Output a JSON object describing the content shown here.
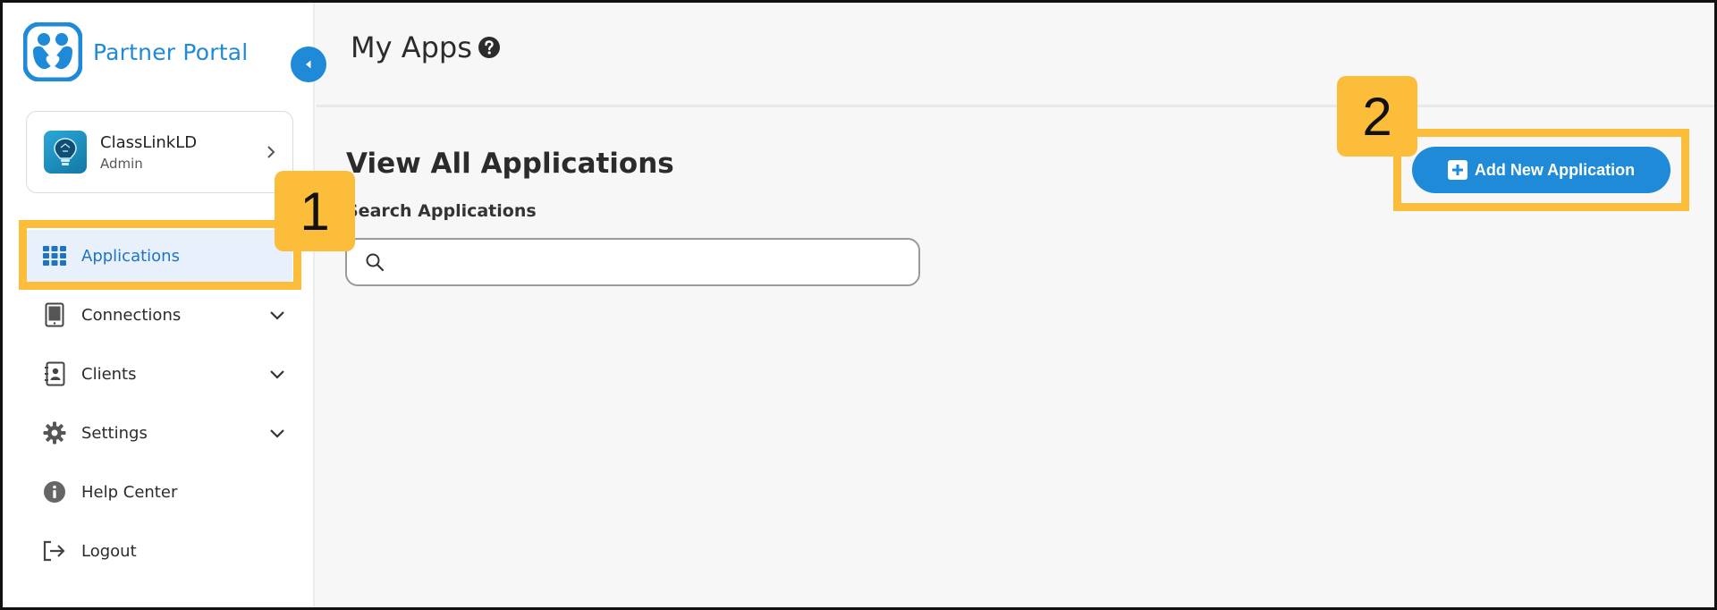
{
  "brand": {
    "name": "Partner Portal",
    "logo_icon": "partner-portal-logo-icon"
  },
  "account": {
    "name": "ClassLinkLD",
    "role": "Admin"
  },
  "nav": {
    "items": [
      {
        "label": "Applications",
        "icon": "grid-icon",
        "active": true
      },
      {
        "label": "Connections",
        "icon": "tablet-icon",
        "expandable": true
      },
      {
        "label": "Clients",
        "icon": "contact-book-icon",
        "expandable": true
      },
      {
        "label": "Settings",
        "icon": "gear-icon",
        "expandable": true
      },
      {
        "label": "Help Center",
        "icon": "info-icon"
      },
      {
        "label": "Logout",
        "icon": "logout-icon"
      }
    ]
  },
  "header": {
    "title": "My Apps",
    "help_icon": "question-circle-icon"
  },
  "main": {
    "section_title": "View All Applications",
    "search_label": "Search Applications",
    "search_value": "",
    "add_button_label": "Add New Application"
  },
  "callouts": [
    {
      "number": "1",
      "target": "Applications"
    },
    {
      "number": "2",
      "target": "Add New Application"
    }
  ],
  "colors": {
    "accent": "#1f8ad8",
    "callout": "#fbbd3a",
    "active_bg": "#e8f1fb"
  }
}
